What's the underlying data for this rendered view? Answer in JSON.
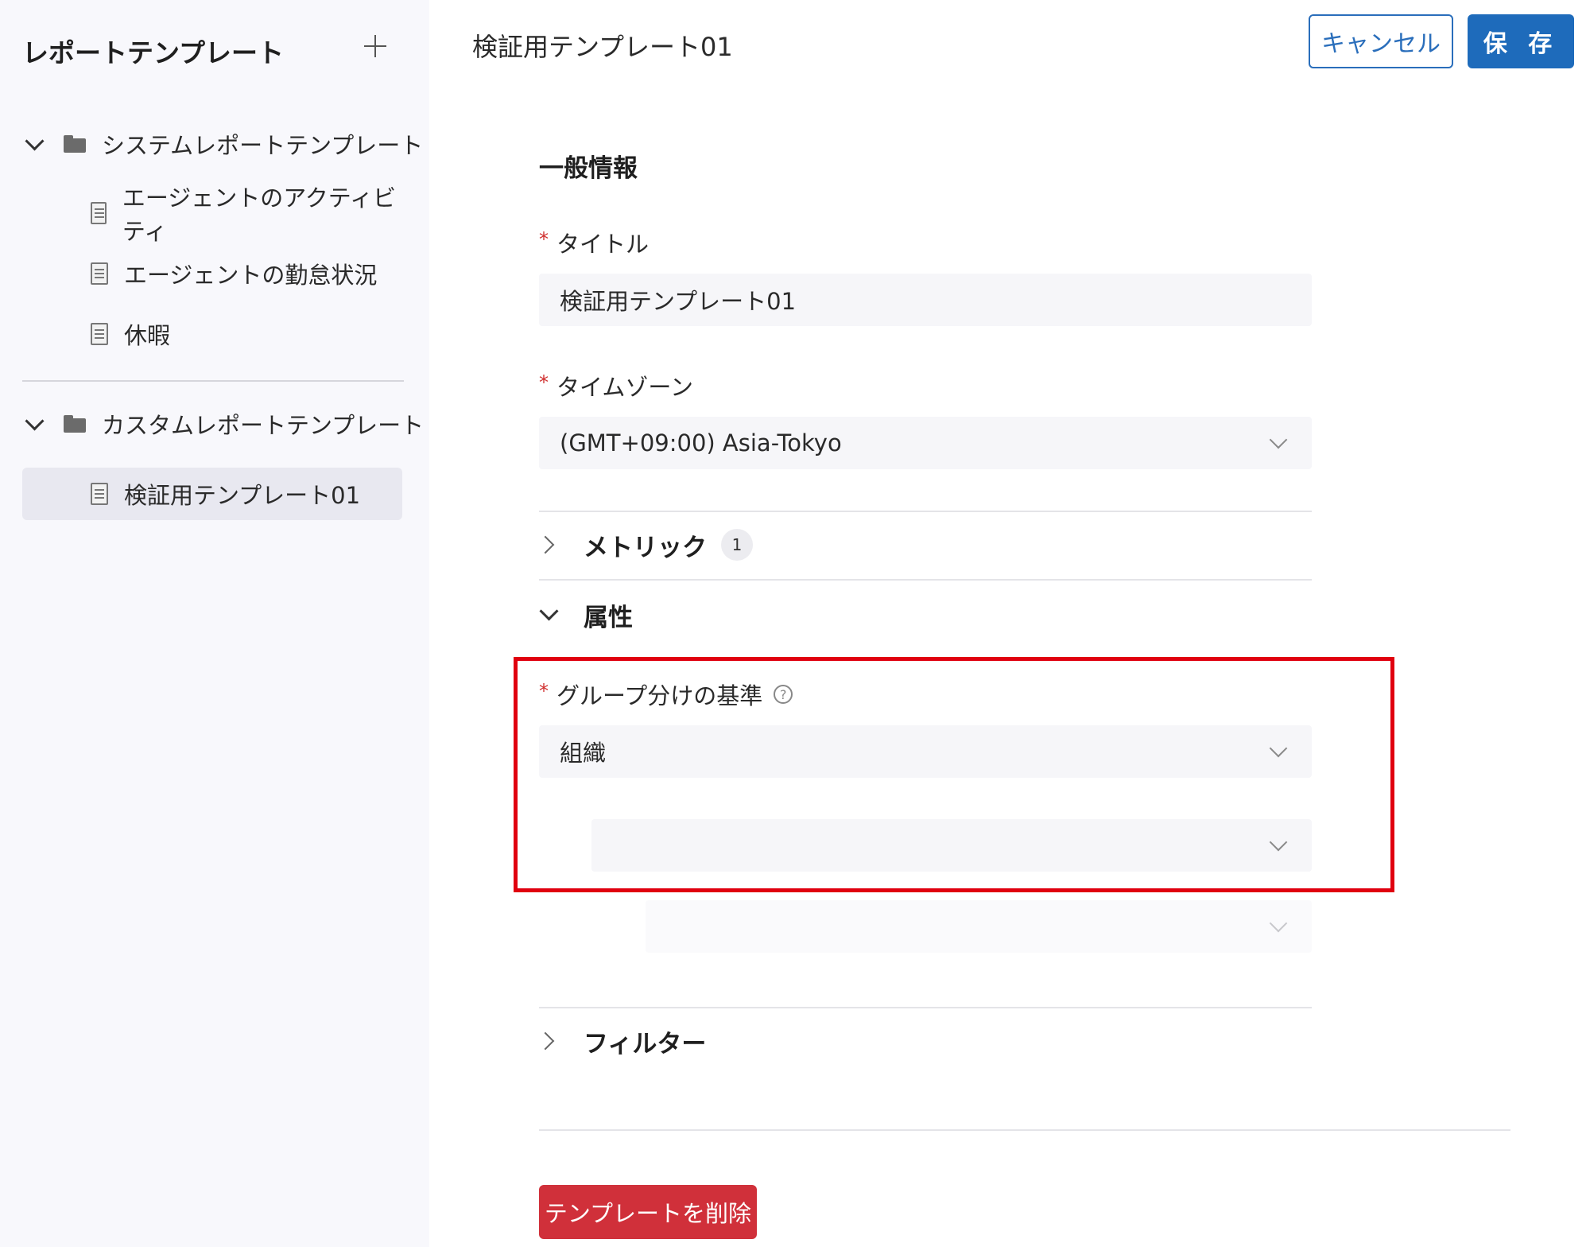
{
  "sidebar": {
    "title": "レポートテンプレート",
    "groups": [
      {
        "label": "システムレポートテンプレート",
        "items": [
          "エージェントのアクティビティ",
          "エージェントの勤怠状況",
          "休暇"
        ]
      },
      {
        "label": "カスタムレポートテンプレート",
        "items": [
          "検証用テンプレート01"
        ]
      }
    ]
  },
  "header": {
    "title": "検証用テンプレート01",
    "cancel_label": "キャンセル",
    "save_label": "保 存"
  },
  "form": {
    "general_heading": "一般情報",
    "title_label": "タイトル",
    "title_value": "検証用テンプレート01",
    "timezone_label": "タイムゾーン",
    "timezone_value": "(GMT+09:00) Asia-Tokyo",
    "metrics_label": "メトリック",
    "metrics_count": "1",
    "attributes_label": "属性",
    "grouping_label": "グループ分けの基準",
    "grouping_value": "組織",
    "grouping_sub1_value": "",
    "grouping_sub2_value": "",
    "filter_label": "フィルター",
    "delete_label": "テンプレートを削除",
    "required_mark": "*",
    "help_glyph": "?"
  },
  "colors": {
    "primary": "#1e6bbb",
    "danger": "#d0303a",
    "highlight": "#e0000f",
    "sidebar_bg": "#f8f8fc"
  }
}
